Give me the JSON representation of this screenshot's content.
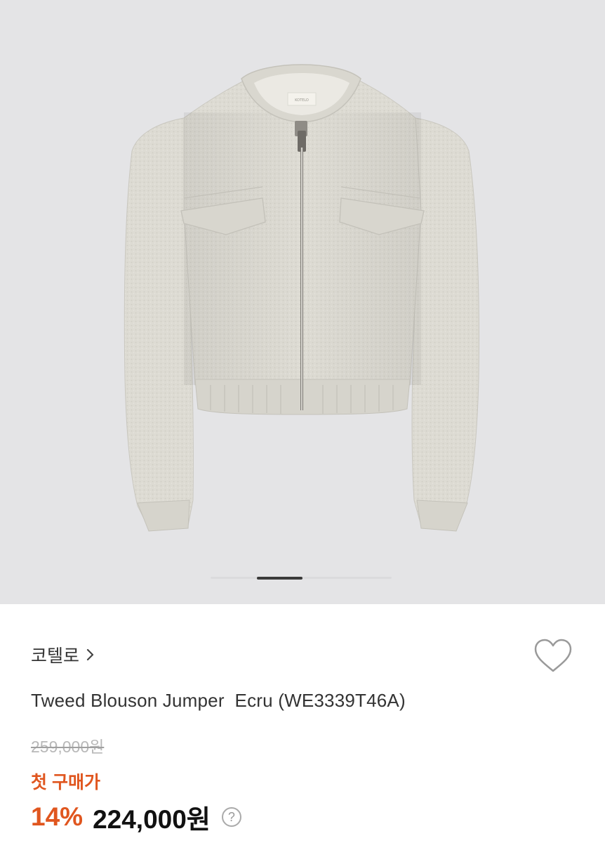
{
  "product": {
    "brand": "코텔로",
    "title": "Tweed Blouson Jumper  Ecru (WE3339T46A)",
    "label_text": "KOTELO"
  },
  "pricing": {
    "original": "259,000원",
    "promo_label": "첫 구매가",
    "discount": "14%",
    "final": "224,000원",
    "help_symbol": "?"
  },
  "icons": {
    "brand_chevron": "chevron-right-icon",
    "wishlist": "heart-outline-icon",
    "help": "question-circle-icon"
  },
  "colors": {
    "accent": "#e0561f",
    "gallery_bg": "#e4e4e6",
    "jacket": "#dddbd3"
  }
}
